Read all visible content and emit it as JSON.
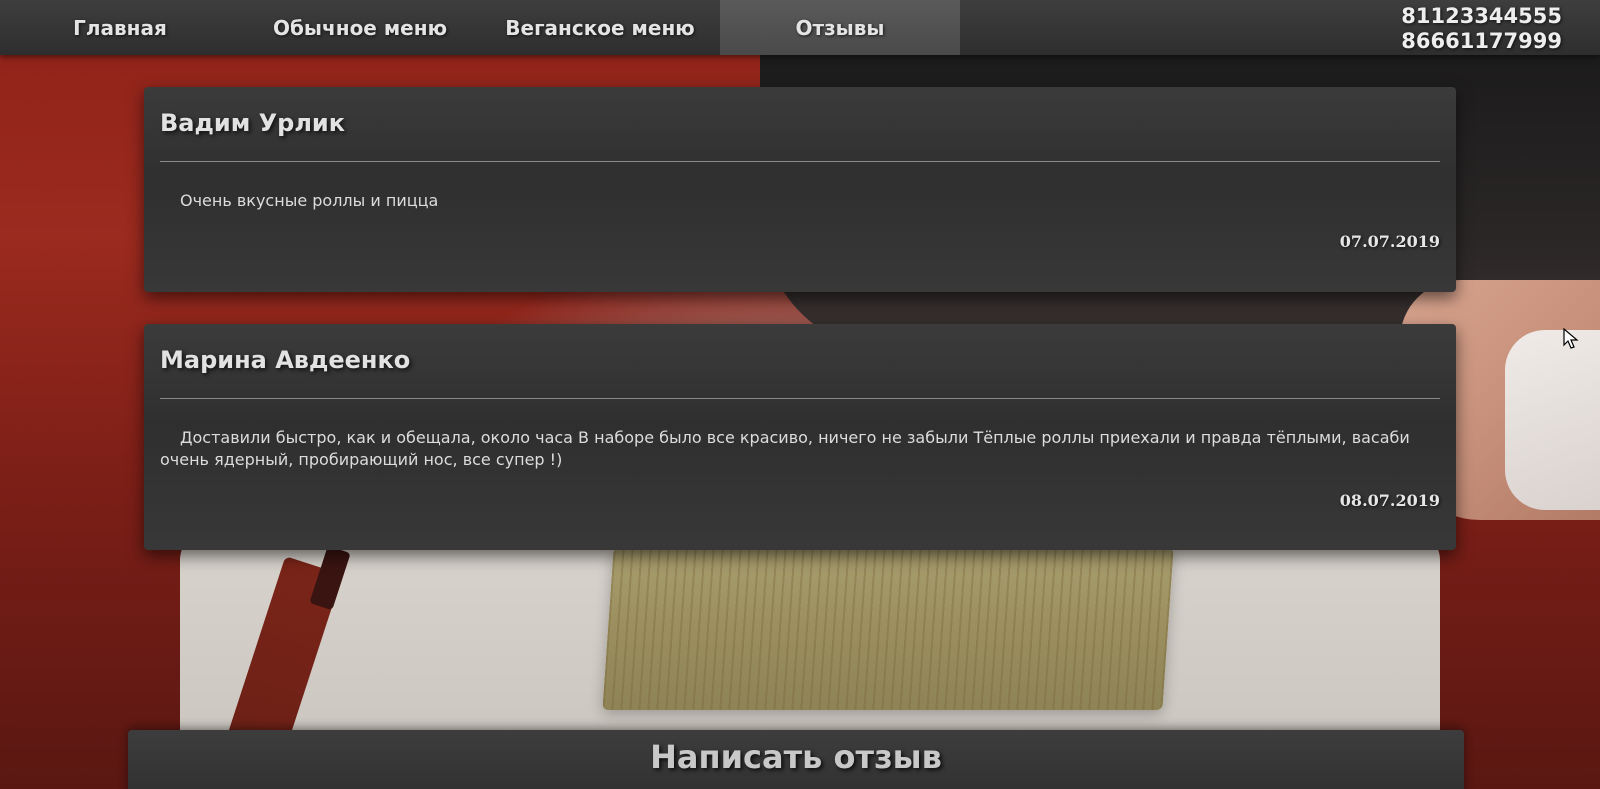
{
  "nav": {
    "items": [
      {
        "label": "Главная",
        "active": false
      },
      {
        "label": "Обычное меню",
        "active": false
      },
      {
        "label": "Веганское меню",
        "active": false
      },
      {
        "label": "Отзывы",
        "active": true
      }
    ],
    "phones": [
      "81123344555",
      "86661177999"
    ]
  },
  "reviews": [
    {
      "name": "Вадим Урлик",
      "text": "Очень вкусные роллы и пицца",
      "date": "07.07.2019"
    },
    {
      "name": "Марина Авдеенко",
      "text": "Доставили быстро, как и обещала, около часа В наборе было все красиво, ничего не забыли Тёплые роллы приехали и правда тёплыми, васаби очень ядерный, пробирающий нос, все супер !)",
      "date": "08.07.2019"
    }
  ],
  "write_review": {
    "label": "Написать отзыв"
  },
  "colors": {
    "nav_bg": "#333333",
    "nav_active": "#4f4f4f",
    "card_bg": "#353535",
    "background_red": "#9b2a1f"
  },
  "icons": {
    "cursor": "mouse-pointer-icon"
  }
}
